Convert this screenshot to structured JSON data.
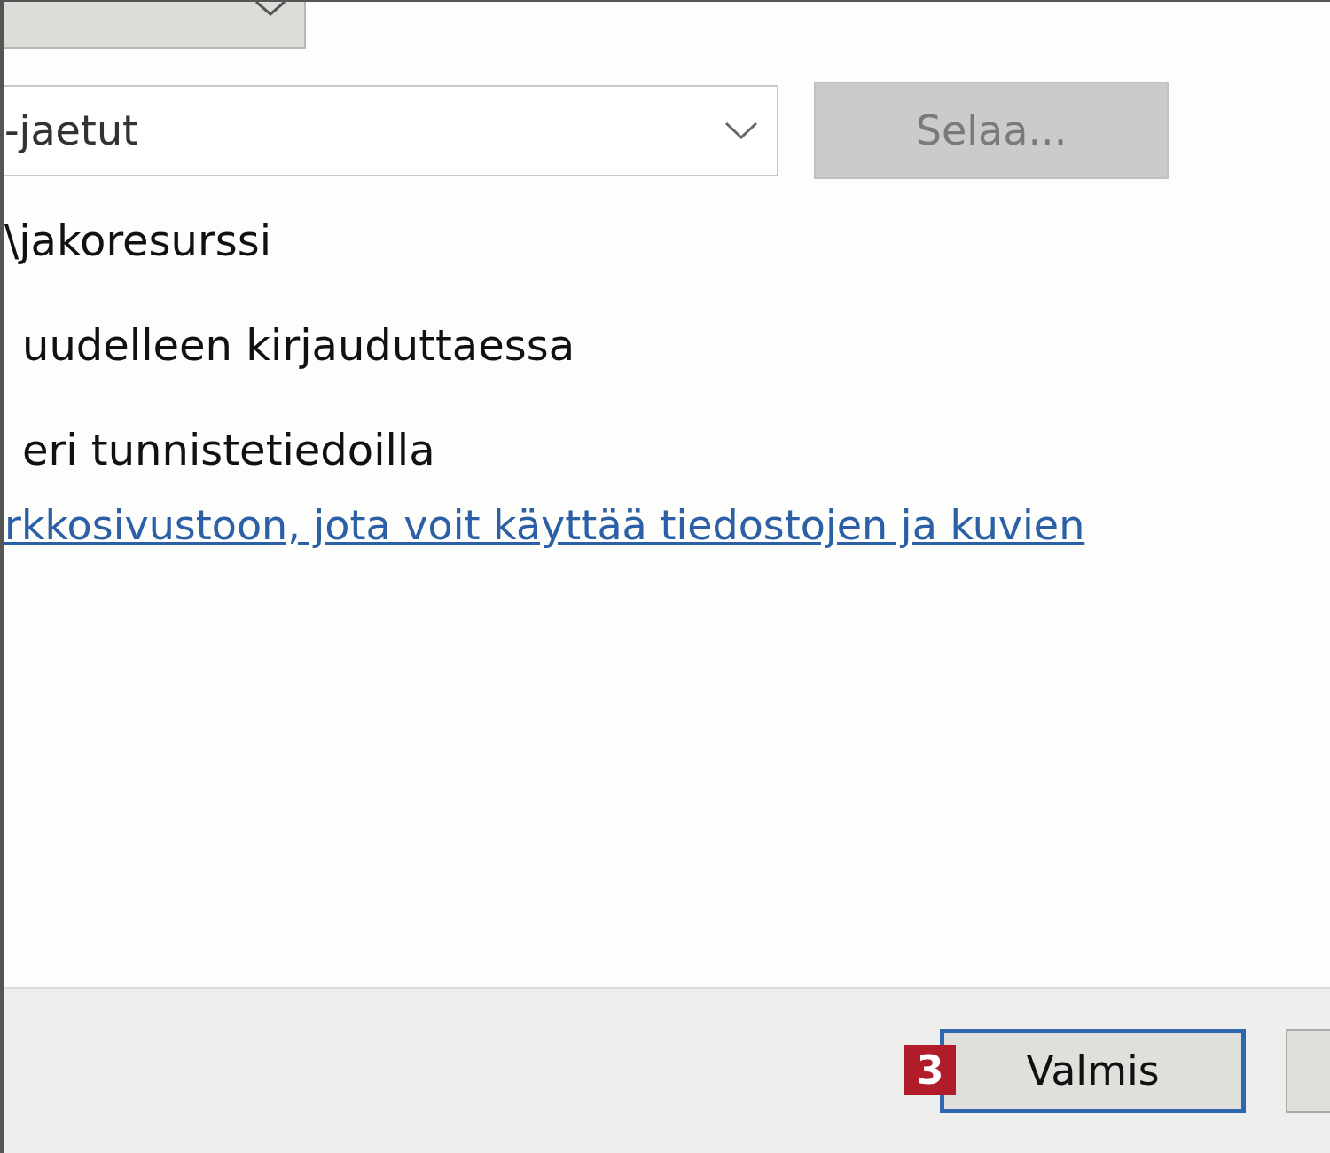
{
  "folder": {
    "value": "-jaetut"
  },
  "browse_button": {
    "label": "Selaa...",
    "disabled": true
  },
  "example": "\\jakoresurssi",
  "options": [
    "uudelleen kirjauduttaessa",
    "eri tunnistetiedoilla"
  ],
  "link": "rkkosivustoon, jota voit käyttää tiedostojen ja kuvien",
  "footer": {
    "badge": "3",
    "finish_button": {
      "label": "Valmis",
      "default": true
    }
  }
}
